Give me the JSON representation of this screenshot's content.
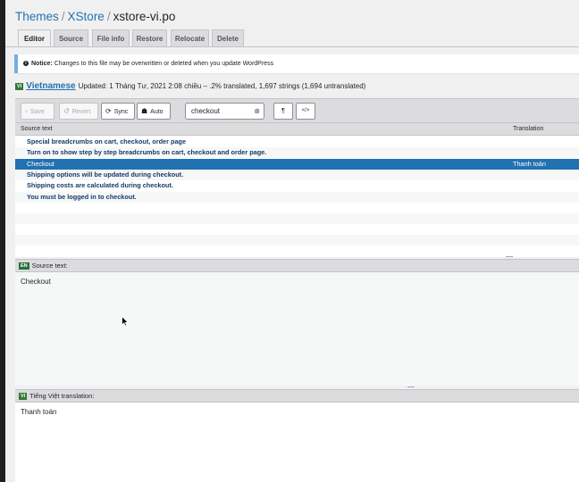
{
  "breadcrumb": {
    "themes": "Themes",
    "theme": "XStore",
    "file": "xstore-vi.po",
    "separator": "/"
  },
  "tabs": [
    "Editor",
    "Source",
    "File info",
    "Restore",
    "Relocate",
    "Delete"
  ],
  "notice": {
    "strong": "Notice:",
    "text": " Changes to this file may be overwritten or deleted when you update WordPress"
  },
  "language": {
    "flag": "VI",
    "name": "Vietnamese",
    "meta": "Updated: 1 Tháng Tư, 2021 2:08 chiều – .2% translated, 1,697 strings (1,694 untranslated)"
  },
  "toolbar": {
    "save": "Save",
    "revert": "Revert",
    "sync": "Sync",
    "auto": "Auto",
    "search_value": "checkout",
    "pilcrow": "¶",
    "code": "</>"
  },
  "list": {
    "col_source": "Source text",
    "col_translation": "Translation",
    "rows": [
      {
        "source": "Special breadcrumbs on cart, checkout, order page",
        "translation": ""
      },
      {
        "source": "Turn on to show step by step breadcrumbs on cart, checkout and order page.",
        "translation": ""
      },
      {
        "source": "Checkout",
        "translation": "Thanh toán"
      },
      {
        "source": "Shipping options will be updated during checkout.",
        "translation": ""
      },
      {
        "source": "Shipping costs are calculated during checkout.",
        "translation": ""
      },
      {
        "source": "You must be logged in to checkout.",
        "translation": ""
      }
    ]
  },
  "source_pane": {
    "flag": "EN",
    "label": "Source text:",
    "value": "Checkout"
  },
  "translation_pane": {
    "flag": "VI",
    "label": "Tiếng Việt translation:",
    "value": "Thanh toán"
  },
  "colors": {
    "accent": "#2271b1",
    "selected_row": "#2271b1",
    "notice_border": "#72aee6",
    "flag_green": "#357935"
  }
}
